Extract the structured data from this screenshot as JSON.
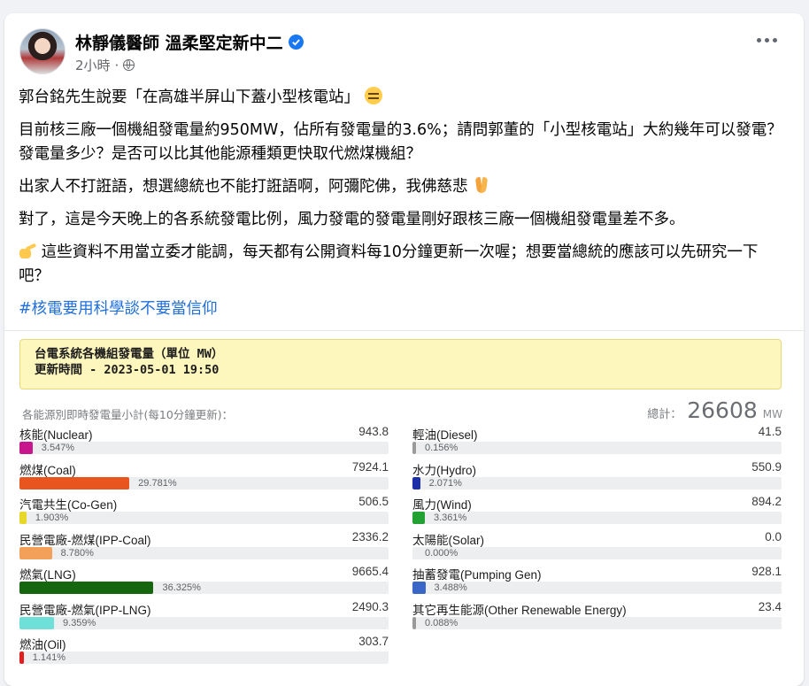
{
  "post": {
    "author": "林靜儀醫師 溫柔堅定新中二",
    "time": "2小時",
    "separator": "·",
    "paragraphs": [
      {
        "text": "郭台銘先生說要「在高雄半屏山下蓋小型核電站」",
        "emoji": "expressionless-face"
      },
      {
        "text": "目前核三廠一個機組發電量約950MW，佔所有發電量的3.6%；請問郭董的「小型核電站」大約幾年可以發電？發電量多少？是否可以比其他能源種類更快取代燃煤機組？",
        "emoji": ""
      },
      {
        "text": "出家人不打誑語，想選總統也不能打誑語啊，阿彌陀佛，我佛慈悲",
        "emoji": "folded-hands"
      },
      {
        "text": "對了，這是今天晚上的各系統發電比例，風力發電的發電量剛好跟核三廠一個機組發電量差不多。",
        "emoji": ""
      }
    ],
    "pointing_paragraph": "這些資料不用當立委才能調，每天都有公開資料每10分鐘更新一次喔；想要當總統的應該可以先研究一下吧？",
    "hashtag": "#核電要用科學談不要當信仰"
  },
  "chart_data": {
    "type": "bar",
    "title": "台電系統各機組發電量（單位 MW）",
    "subtitle": "更新時間 - 2023-05-01 19:50",
    "caption": "各能源別即時發電量小計(每10分鐘更新)：",
    "total_label": "總計：",
    "total_value": "26608",
    "total_unit": "MW",
    "categories": [
      "核能(Nuclear)",
      "燃煤(Coal)",
      "汽電共生(Co-Gen)",
      "民營電廠-燃煤(IPP-Coal)",
      "燃氣(LNG)",
      "民營電廠-燃氣(IPP-LNG)",
      "燃油(Oil)",
      "輕油(Diesel)",
      "水力(Hydro)",
      "風力(Wind)",
      "太陽能(Solar)",
      "抽蓄發電(Pumping Gen)",
      "其它再生能源(Other Renewable Energy)"
    ],
    "values": [
      943.8,
      7924.1,
      506.5,
      2336.2,
      9665.4,
      2490.3,
      303.7,
      41.5,
      550.9,
      894.2,
      0.0,
      928.1,
      23.4
    ],
    "value_labels": [
      "943.8",
      "7924.1",
      "506.5",
      "2336.2",
      "9665.4",
      "2490.3",
      "303.7",
      "41.5",
      "550.9",
      "894.2",
      "0.0",
      "928.1",
      "23.4"
    ],
    "percents": [
      3.547,
      29.781,
      1.903,
      8.78,
      36.325,
      9.359,
      1.141,
      0.156,
      2.071,
      3.361,
      0.0,
      3.488,
      0.088
    ],
    "percent_labels": [
      "3.547%",
      "29.781%",
      "1.903%",
      "8.780%",
      "36.325%",
      "9.359%",
      "1.141%",
      "0.156%",
      "2.071%",
      "3.361%",
      "0.000%",
      "3.488%",
      "0.088%"
    ],
    "colors": [
      "#c8168d",
      "#e8551f",
      "#e8d629",
      "#f2a05a",
      "#16650f",
      "#6fe0d8",
      "#e02020",
      "#9a9a9a",
      "#1c2fa8",
      "#23a233",
      "#f2c94c",
      "#3a66c8",
      "#9a9a9a"
    ],
    "columns": {
      "left": [
        0,
        1,
        2,
        3,
        4,
        5,
        6
      ],
      "right": [
        7,
        8,
        9,
        10,
        11,
        12
      ]
    }
  }
}
